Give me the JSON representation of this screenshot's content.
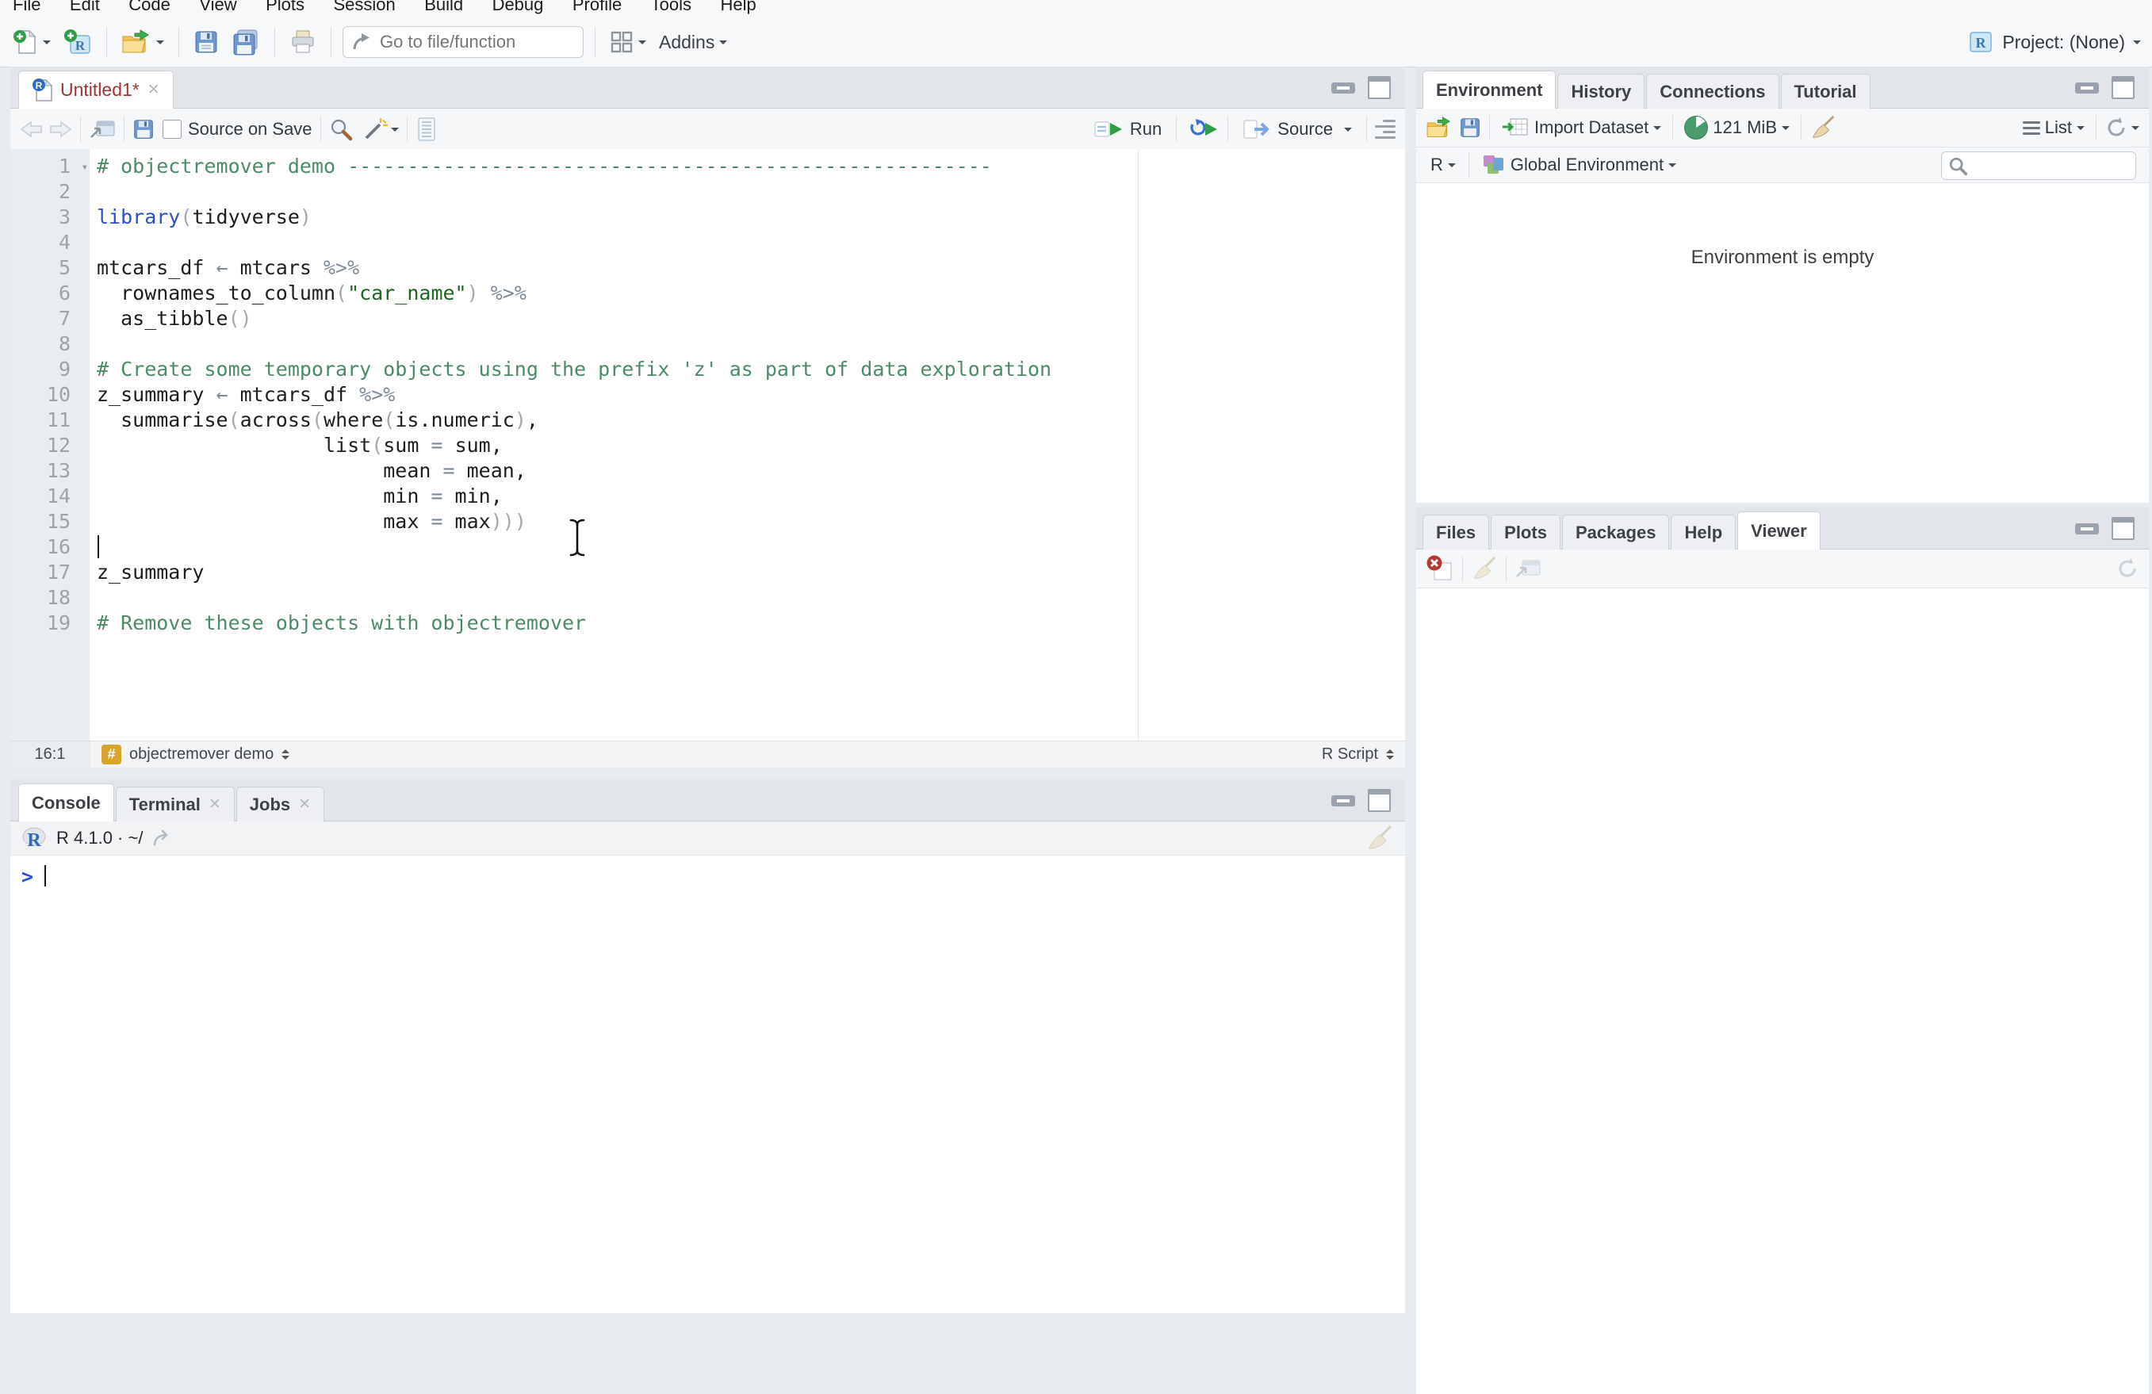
{
  "menu": {
    "items": [
      "File",
      "Edit",
      "Code",
      "View",
      "Plots",
      "Session",
      "Build",
      "Debug",
      "Profile",
      "Tools",
      "Help"
    ]
  },
  "toolbar": {
    "goto_placeholder": "Go to file/function",
    "addins_label": "Addins",
    "project_label": "Project: (None)"
  },
  "editor": {
    "tab_title": "Untitled1*",
    "toolbar": {
      "source_on_save": "Source on Save",
      "run_label": "Run",
      "source_label": "Source"
    },
    "status": {
      "position": "16:1",
      "section": "objectremover demo",
      "filetype": "R Script"
    },
    "code": {
      "lines": [
        [
          [
            "com",
            "# objectremover demo ------------------------------------------------------"
          ]
        ],
        [],
        [
          [
            "kw",
            "library"
          ],
          [
            "par",
            "("
          ],
          [
            "txt",
            "tidyverse"
          ],
          [
            "par",
            ")"
          ]
        ],
        [],
        [
          [
            "txt",
            "mtcars_df "
          ],
          [
            "op",
            "←"
          ],
          [
            "txt",
            " mtcars "
          ],
          [
            "op",
            "%>%"
          ]
        ],
        [
          [
            "txt",
            "  rownames_to_column"
          ],
          [
            "par",
            "("
          ],
          [
            "str",
            "\"car_name\""
          ],
          [
            "par",
            ")"
          ],
          [
            "txt",
            " "
          ],
          [
            "op",
            "%>%"
          ]
        ],
        [
          [
            "txt",
            "  as_tibble"
          ],
          [
            "par",
            "()"
          ]
        ],
        [],
        [
          [
            "com",
            "# Create some temporary objects using the prefix 'z' as part of data exploration"
          ]
        ],
        [
          [
            "txt",
            "z_summary "
          ],
          [
            "op",
            "←"
          ],
          [
            "txt",
            " mtcars_df "
          ],
          [
            "op",
            "%>%"
          ]
        ],
        [
          [
            "txt",
            "  summarise"
          ],
          [
            "par",
            "("
          ],
          [
            "txt",
            "across"
          ],
          [
            "par",
            "("
          ],
          [
            "txt",
            "where"
          ],
          [
            "par",
            "("
          ],
          [
            "txt",
            "is.numeric"
          ],
          [
            "par",
            ")"
          ],
          [
            "txt",
            ","
          ]
        ],
        [
          [
            "txt",
            "                   list"
          ],
          [
            "par",
            "("
          ],
          [
            "txt",
            "sum "
          ],
          [
            "op",
            "="
          ],
          [
            "txt",
            " sum,"
          ]
        ],
        [
          [
            "txt",
            "                        mean "
          ],
          [
            "op",
            "="
          ],
          [
            "txt",
            " mean,"
          ]
        ],
        [
          [
            "txt",
            "                        min "
          ],
          [
            "op",
            "="
          ],
          [
            "txt",
            " min,"
          ]
        ],
        [
          [
            "txt",
            "                        max "
          ],
          [
            "op",
            "="
          ],
          [
            "txt",
            " max"
          ],
          [
            "par",
            ")))"
          ]
        ],
        [],
        [
          [
            "txt",
            "z_summary"
          ]
        ],
        [],
        [
          [
            "com",
            "# Remove these objects with objectremover"
          ]
        ]
      ]
    }
  },
  "console": {
    "tabs": [
      "Console",
      "Terminal",
      "Jobs"
    ],
    "version_line": "R 4.1.0 · ~/",
    "prompt": ">"
  },
  "environment": {
    "tabs": [
      "Environment",
      "History",
      "Connections",
      "Tutorial"
    ],
    "toolbar": {
      "import_label": "Import Dataset",
      "memory_label": "121 MiB",
      "list_label": "List"
    },
    "row2": {
      "lang_label": "R",
      "env_label": "Global Environment"
    },
    "empty_text": "Environment is empty"
  },
  "files": {
    "tabs": [
      "Files",
      "Plots",
      "Packages",
      "Help",
      "Viewer"
    ]
  },
  "colors": {
    "comment": "#4d8a67",
    "string": "#1e6620",
    "keyword": "#2b50c8",
    "operator": "#7d8a96",
    "paren": "#a2a9b1",
    "tab_modified": "#9c3636",
    "prompt_blue": "#2a52cc",
    "section_badge": "#d9a42a"
  }
}
